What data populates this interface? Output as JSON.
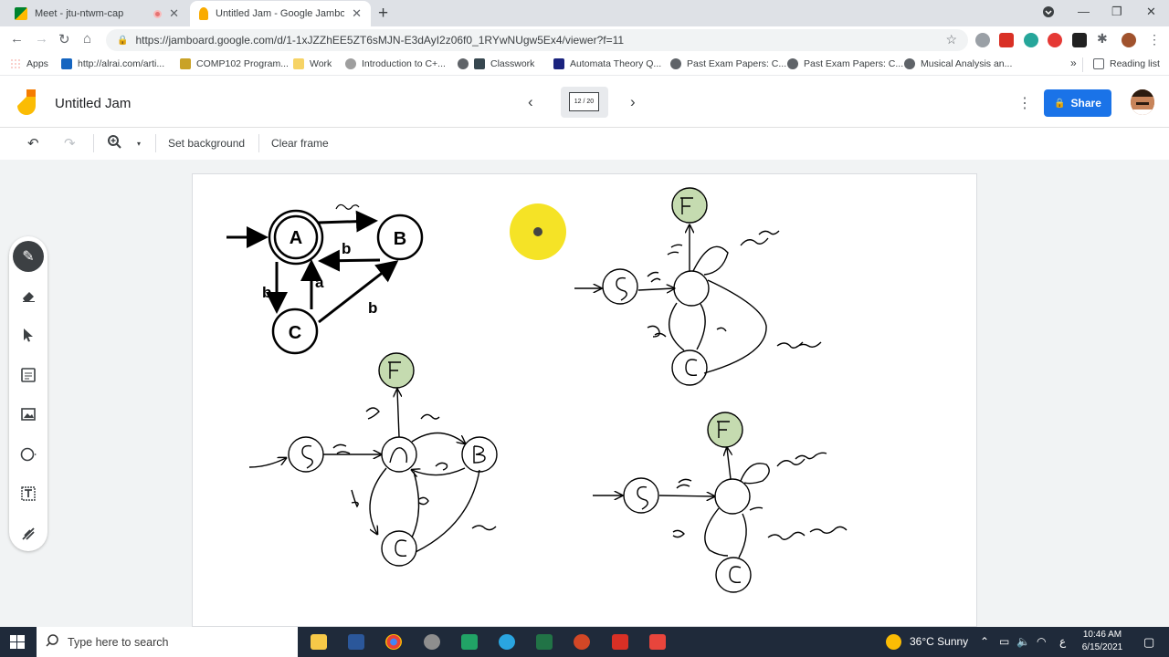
{
  "browser": {
    "tabs": [
      {
        "title": "Meet - jtu-ntwm-cap",
        "active": false
      },
      {
        "title": "Untitled Jam - Google Jamboard",
        "active": true
      }
    ],
    "url": "https://jamboard.google.com/d/1-1xJZZhEE5ZT6sMJN-E3dAyI2z06f0_1RYwNUgw5Ex4/viewer?f=11",
    "bookmarks": [
      "Apps",
      "http://alrai.com/arti...",
      "COMP102 Program...",
      "Work",
      "Introduction to C+...",
      "Classwork",
      "Automata Theory Q...",
      "Past Exam Papers: C...",
      "Past Exam Papers: C...",
      "Musical Analysis an..."
    ],
    "reading_list": "Reading list",
    "more_bookmarks": "»"
  },
  "jamboard": {
    "title": "Untitled Jam",
    "frame_counter": "12 / 20",
    "share_label": "Share",
    "toolbar": {
      "set_background": "Set background",
      "clear_frame": "Clear frame"
    }
  },
  "diagram": {
    "typed_states": [
      "A",
      "B",
      "C"
    ],
    "typed_edge_labels": [
      "b",
      "a",
      "b",
      "b"
    ],
    "handwritten_marks": [
      "a",
      "F",
      "S",
      "a",
      "b",
      "a",
      "b",
      "c"
    ]
  },
  "taskbar": {
    "search_placeholder": "Type here to search",
    "weather": "36°C  Sunny",
    "lang": "ع",
    "time": "10:46 AM",
    "date": "6/15/2021"
  },
  "colors": {
    "share_blue": "#1a73e8",
    "accept_state_fill": "#c5dbb0",
    "laser_yellow": "#f4e21a"
  }
}
